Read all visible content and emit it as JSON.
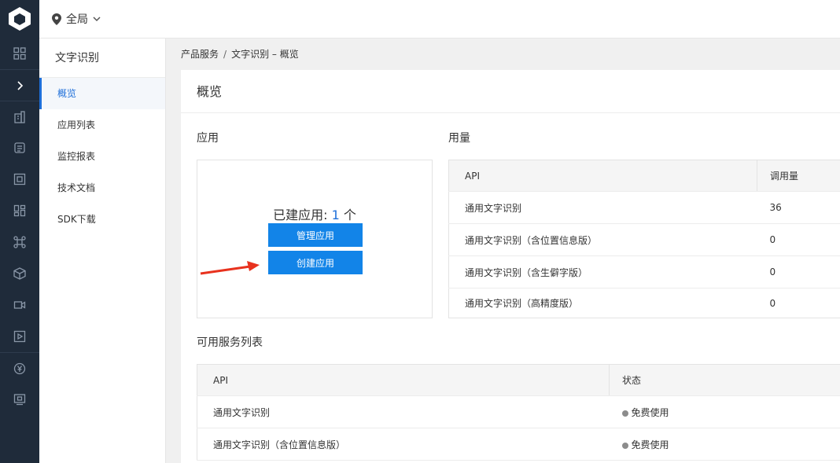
{
  "header": {
    "region": "全局"
  },
  "rail_icons": [
    "grid-icon",
    "chevron-right-icon",
    "building-icon",
    "database-icon",
    "frame-icon",
    "dashboard-icon",
    "network-icon",
    "cube-icon",
    "video-icon",
    "play-icon",
    "yen-icon",
    "monitor-icon"
  ],
  "subnav": {
    "title": "文字识别",
    "items": [
      {
        "label": "概览",
        "active": true
      },
      {
        "label": "应用列表"
      },
      {
        "label": "监控报表"
      },
      {
        "label": "技术文档"
      },
      {
        "label": "SDK下载"
      }
    ]
  },
  "breadcrumb": {
    "parent": "产品服务",
    "separator": "/",
    "current": "文字识别 – 概览"
  },
  "page": {
    "title": "概览"
  },
  "apps": {
    "section_title": "应用",
    "created_prefix": "已建应用: ",
    "count": "1",
    "unit": " 个",
    "manage_button": "管理应用",
    "create_button": "创建应用"
  },
  "usage": {
    "section_title": "用量",
    "headers": [
      "API",
      "调用量"
    ],
    "rows": [
      [
        "通用文字识别",
        "36"
      ],
      [
        "通用文字识别（含位置信息版）",
        "0"
      ],
      [
        "通用文字识别（含生僻字版）",
        "0"
      ],
      [
        "通用文字识别（高精度版）",
        "0"
      ]
    ]
  },
  "services": {
    "section_title": "可用服务列表",
    "headers": [
      "API",
      "状态"
    ],
    "rows": [
      [
        "通用文字识别",
        "免费使用"
      ],
      [
        "通用文字识别（含位置信息版）",
        "免费使用"
      ]
    ]
  },
  "colors": {
    "accent": "#1e6fd9",
    "button": "#1284e8",
    "rail": "#1f2b3a",
    "arrow": "#e8321e"
  }
}
